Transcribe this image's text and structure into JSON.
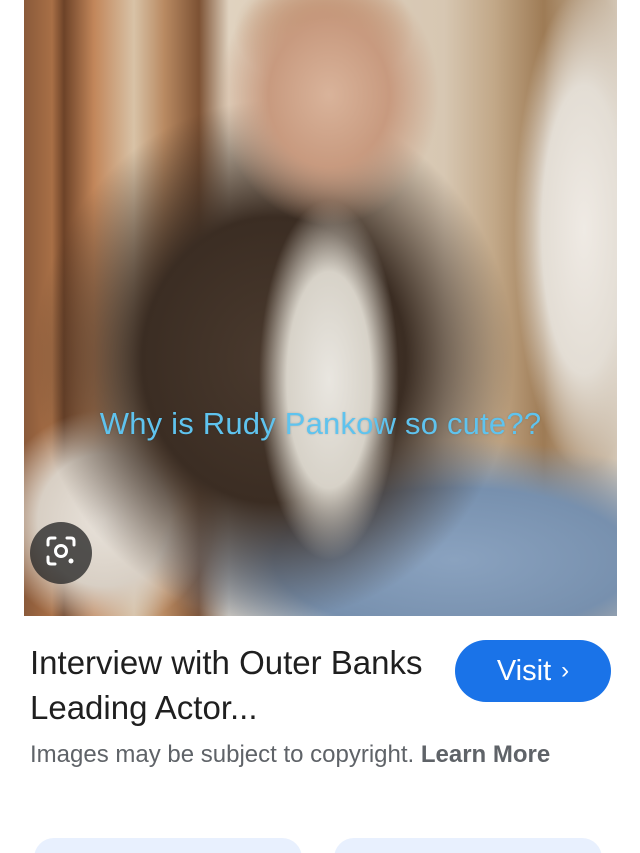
{
  "image": {
    "overlay_caption": "Why is Rudy Pankow so cute??",
    "lens_icon": "google-lens-icon"
  },
  "result": {
    "title": "Interview with Outer Banks Leading Actor...",
    "visit_label": "Visit",
    "visit_chevron": "›",
    "copyright_text": "Images may be subject to copyright.",
    "learn_more_label": "Learn More"
  },
  "colors": {
    "accent": "#1a73e8",
    "caption": "#5fc3ee",
    "chip_bg": "#e8f0fe"
  }
}
